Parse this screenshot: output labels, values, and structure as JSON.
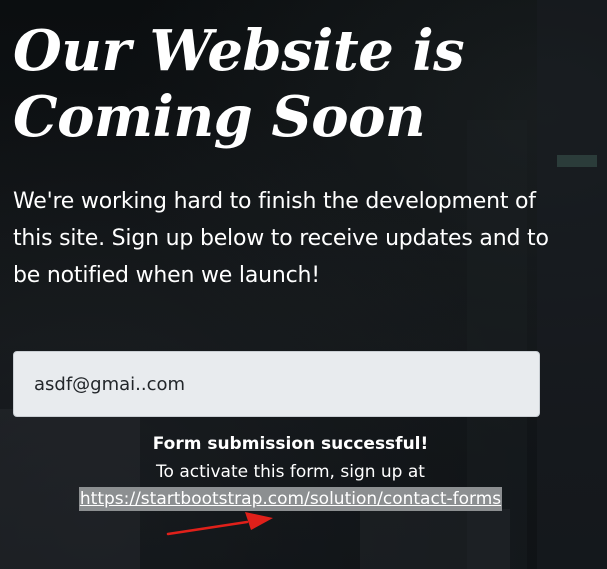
{
  "page": {
    "headline": "Our Website is Coming Soon",
    "lead": "We're working hard to finish the development of this site. Sign up below to receive updates and to be notified when we launch!"
  },
  "form": {
    "email_value": "asdf@gmai..com"
  },
  "submission": {
    "title": "Form submission successful!",
    "text": "To activate this form, sign up at",
    "link_text": "https://startbootstrap.com/solution/contact-forms"
  },
  "colors": {
    "background": "#0b0d0f",
    "text": "#ffffff",
    "input_bg": "#e8ebee",
    "link_highlight": "#8c8f91",
    "annotation": "#e0201a"
  },
  "icons": {
    "annotation": "red-arrow-icon"
  }
}
